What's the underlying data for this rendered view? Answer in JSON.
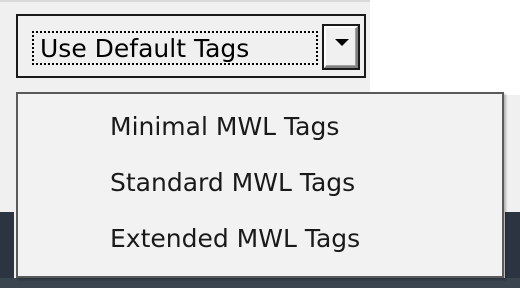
{
  "combo": {
    "value": "Use Default Tags",
    "arrow_icon": "chevron-down-icon"
  },
  "dropdown": {
    "options": [
      {
        "label": "Minimal MWL Tags"
      },
      {
        "label": "Standard MWL Tags"
      },
      {
        "label": "Extended MWL Tags"
      }
    ]
  },
  "colors": {
    "window_bg": "#f0f0f0",
    "dropdown_bg": "#f2f2f2",
    "border": "#1a1a1a",
    "text": "#000000"
  }
}
